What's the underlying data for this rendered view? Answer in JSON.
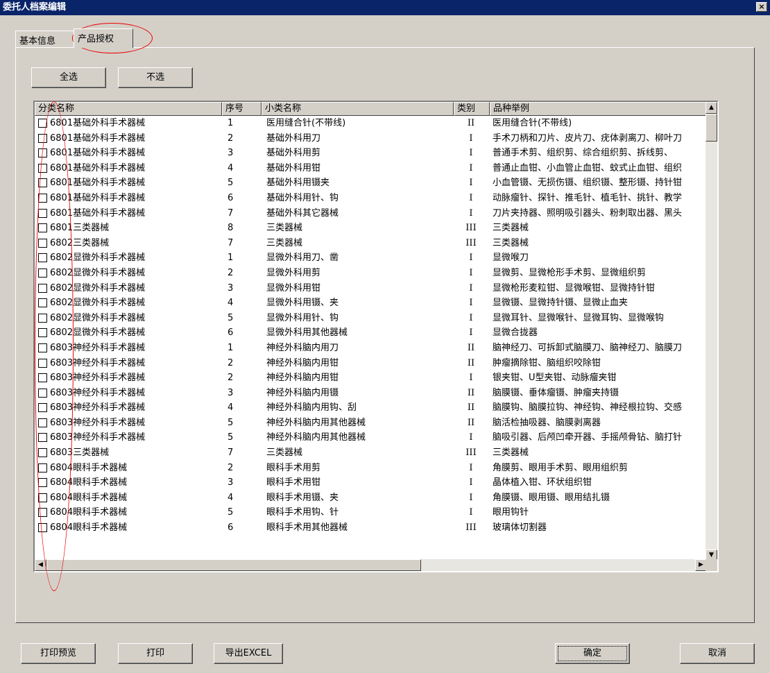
{
  "window": {
    "title": "委托人档案编辑",
    "close_label": "×"
  },
  "tabs": [
    {
      "label": "基本信息"
    },
    {
      "label": "产品授权"
    }
  ],
  "buttons": {
    "select_all": "全选",
    "select_none": "不选",
    "print_preview": "打印预览",
    "print": "打印",
    "export_excel": "导出EXCEL",
    "ok": "确定",
    "cancel": "取消"
  },
  "columns": [
    "分类名称",
    "序号",
    "小类名称",
    "类别",
    "品种举例"
  ],
  "rows": [
    {
      "cat": "6801基础外科手术器械",
      "no": "1",
      "sub": "医用缝合针(不带线)",
      "cls": "II",
      "ex": "医用缝合针(不带线)"
    },
    {
      "cat": "6801基础外科手术器械",
      "no": "2",
      "sub": "基础外科用刀",
      "cls": "I",
      "ex": "手术刀柄和刀片、皮片刀、疣体剥离刀、柳叶刀"
    },
    {
      "cat": "6801基础外科手术器械",
      "no": "3",
      "sub": "基础外科用剪",
      "cls": "I",
      "ex": "普通手术剪、组织剪、综合组织剪、拆线剪、"
    },
    {
      "cat": "6801基础外科手术器械",
      "no": "4",
      "sub": "基础外科用钳",
      "cls": "I",
      "ex": "普通止血钳、小血管止血钳、蚊式止血钳、组织"
    },
    {
      "cat": "6801基础外科手术器械",
      "no": "5",
      "sub": "基础外科用镊夹",
      "cls": "I",
      "ex": "小血管镊、无损伤镊、组织镊、整形镊、持针钳"
    },
    {
      "cat": "6801基础外科手术器械",
      "no": "6",
      "sub": "基础外科用针、钩",
      "cls": "I",
      "ex": "动脉瘤针、探针、推毛针、植毛针、挑针、教学"
    },
    {
      "cat": "6801基础外科手术器械",
      "no": "7",
      "sub": "基础外科其它器械",
      "cls": "I",
      "ex": "刀片夹持器、照明吸引器头、粉刺取出器、黑头"
    },
    {
      "cat": "6801三类器械",
      "no": "8",
      "sub": "三类器械",
      "cls": "III",
      "ex": "三类器械"
    },
    {
      "cat": "6802三类器械",
      "no": "7",
      "sub": "三类器械",
      "cls": "III",
      "ex": "三类器械"
    },
    {
      "cat": "6802显微外科手术器械",
      "no": "1",
      "sub": "显微外科用刀、凿",
      "cls": "I",
      "ex": "显微喉刀"
    },
    {
      "cat": "6802显微外科手术器械",
      "no": "2",
      "sub": "显微外科用剪",
      "cls": "I",
      "ex": "显微剪、显微枪形手术剪、显微组织剪"
    },
    {
      "cat": "6802显微外科手术器械",
      "no": "3",
      "sub": "显微外科用钳",
      "cls": "I",
      "ex": "显微枪形麦粒钳、显微喉钳、显微持针钳"
    },
    {
      "cat": "6802显微外科手术器械",
      "no": "4",
      "sub": "显微外科用镊、夹",
      "cls": "I",
      "ex": "显微镊、显微持针镊、显微止血夹"
    },
    {
      "cat": "6802显微外科手术器械",
      "no": "5",
      "sub": "显微外科用针、钩",
      "cls": "I",
      "ex": "显微耳针、显微喉针、显微耳钩、显微喉钩"
    },
    {
      "cat": "6802显微外科手术器械",
      "no": "6",
      "sub": "显微外科用其他器械",
      "cls": "I",
      "ex": "显微合拢器"
    },
    {
      "cat": "6803神经外科手术器械",
      "no": "1",
      "sub": "神经外科脑内用刀",
      "cls": "II",
      "ex": "脑神经刀、可拆卸式脑膜刀、脑神经刀、脑膜刀"
    },
    {
      "cat": "6803神经外科手术器械",
      "no": "2",
      "sub": "神经外科脑内用钳",
      "cls": "II",
      "ex": "肿瘤摘除钳、脑组织咬除钳"
    },
    {
      "cat": "6803神经外科手术器械",
      "no": "2",
      "sub": "神经外科脑内用钳",
      "cls": "I",
      "ex": "银夹钳、U型夹钳、动脉瘤夹钳"
    },
    {
      "cat": "6803神经外科手术器械",
      "no": "3",
      "sub": "神经外科脑内用镊",
      "cls": "II",
      "ex": "脑膜镊、垂体瘤镊、肿瘤夹持镊"
    },
    {
      "cat": "6803神经外科手术器械",
      "no": "4",
      "sub": "神经外科脑内用钩、刮",
      "cls": "II",
      "ex": "脑膜钩、脑膜拉钩、神经钩、神经根拉钩、交感"
    },
    {
      "cat": "6803神经外科手术器械",
      "no": "5",
      "sub": "神经外科脑内用其他器械",
      "cls": "II",
      "ex": "脑活检抽吸器、脑膜剥离器"
    },
    {
      "cat": "6803神经外科手术器械",
      "no": "5",
      "sub": "神经外科脑内用其他器械",
      "cls": "I",
      "ex": "脑吸引器、后颅凹牵开器、手摇颅骨钻、脑打针"
    },
    {
      "cat": "6803三类器械",
      "no": "7",
      "sub": "三类器械",
      "cls": "III",
      "ex": "三类器械"
    },
    {
      "cat": "6804眼科手术器械",
      "no": "2",
      "sub": "眼科手术用剪",
      "cls": "I",
      "ex": "角膜剪、眼用手术剪、眼用组织剪"
    },
    {
      "cat": "6804眼科手术器械",
      "no": "3",
      "sub": "眼科手术用钳",
      "cls": "I",
      "ex": "晶体植入钳、环状组织钳"
    },
    {
      "cat": "6804眼科手术器械",
      "no": "4",
      "sub": "眼科手术用镊、夹",
      "cls": "I",
      "ex": "角膜镊、眼用镊、眼用结扎镊"
    },
    {
      "cat": "6804眼科手术器械",
      "no": "5",
      "sub": "眼科手术用钩、针",
      "cls": "I",
      "ex": "眼用钩针"
    },
    {
      "cat": "6804眼科手术器械",
      "no": "6",
      "sub": "眼科手术用其他器械",
      "cls": "III",
      "ex": "玻璃体切割器"
    }
  ]
}
